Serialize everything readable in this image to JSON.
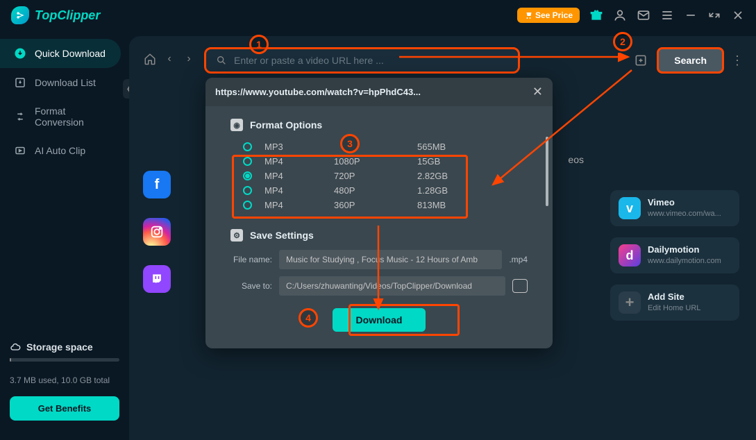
{
  "app": {
    "name": "TopClipper"
  },
  "titlebar": {
    "see_price": "See Price"
  },
  "sidebar": {
    "items": [
      {
        "label": "Quick Download"
      },
      {
        "label": "Download List"
      },
      {
        "label": "Format Conversion"
      },
      {
        "label": "AI Auto Clip"
      }
    ],
    "storage_title": "Storage space",
    "storage_text": "3.7 MB used, 10.0 GB total",
    "get_benefits": "Get Benefits"
  },
  "toolbar": {
    "search_placeholder": "Enter or paste a video URL here ...",
    "search_label": "Search"
  },
  "content": {
    "videos_label": "eos",
    "cards": [
      {
        "title": "Vimeo",
        "sub": "www.vimeo.com/wa..."
      },
      {
        "title": "Dailymotion",
        "sub": "www.dailymotion.com"
      },
      {
        "title": "Add Site",
        "sub": "Edit Home URL"
      }
    ]
  },
  "modal": {
    "url": "https://www.youtube.com/watch?v=hpPhdC43...",
    "format_title": "Format Options",
    "formats": [
      {
        "type": "MP3",
        "res": "",
        "size": "565MB",
        "checked": false
      },
      {
        "type": "MP4",
        "res": "1080P",
        "size": "15GB",
        "checked": false
      },
      {
        "type": "MP4",
        "res": "720P",
        "size": "2.82GB",
        "checked": true
      },
      {
        "type": "MP4",
        "res": "480P",
        "size": "1.28GB",
        "checked": false
      },
      {
        "type": "MP4",
        "res": "360P",
        "size": "813MB",
        "checked": false
      }
    ],
    "save_title": "Save Settings",
    "file_name_label": "File name:",
    "file_name_value": "Music for Studying , Focus Music - 12 Hours of Amb",
    "file_ext": ".mp4",
    "save_to_label": "Save to:",
    "save_to_value": "C:/Users/zhuwanting/Videos/TopClipper/Download",
    "download_label": "Download"
  },
  "callouts": {
    "c1": "1",
    "c2": "2",
    "c3": "3",
    "c4": "4"
  }
}
